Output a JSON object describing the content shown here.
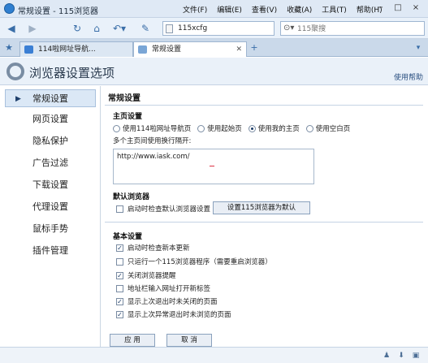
{
  "window": {
    "title": "常规设置 - 115浏览器"
  },
  "menu": [
    "文件(F)",
    "编辑(E)",
    "查看(V)",
    "收藏(A)",
    "工具(T)",
    "帮助(H)"
  ],
  "toolbar": {
    "url": "115xcfg",
    "search_placeholder": "115聚搜"
  },
  "tabs": [
    {
      "label": "114啦网址导航...",
      "active": false
    },
    {
      "label": "常规设置",
      "active": true
    }
  ],
  "page": {
    "heading": "浏览器设置选项",
    "help": "使用帮助"
  },
  "sidebar": {
    "items": [
      {
        "label": "常规设置",
        "active": true
      },
      {
        "label": "网页设置"
      },
      {
        "label": "隐私保护"
      },
      {
        "label": "广告过滤"
      },
      {
        "label": "下载设置"
      },
      {
        "label": "代理设置"
      },
      {
        "label": "鼠标手势"
      },
      {
        "label": "插件管理"
      }
    ]
  },
  "content": {
    "title": "常规设置",
    "homepage": {
      "heading": "主页设置",
      "options": [
        {
          "label": "使用114啦网址导航页",
          "checked": false
        },
        {
          "label": "使用起始页",
          "checked": false
        },
        {
          "label": "使用我的主页",
          "checked": true
        },
        {
          "label": "使用空白页",
          "checked": false
        }
      ],
      "hint": "多个主页间使用换行隔开:",
      "textarea": "http://www.iask.com/"
    },
    "default_browser": {
      "heading": "默认浏览器",
      "check_label": "启动时检查默认浏览器设置",
      "checked": false,
      "button": "设置115浏览器为默认"
    },
    "basic": {
      "heading": "基本设置",
      "items": [
        {
          "label": "启动时检查新本更新",
          "checked": true
        },
        {
          "label": "只运行一个115浏览器程序（需要重启浏览器）",
          "checked": false
        },
        {
          "label": "关闭浏览器提醒",
          "checked": true
        },
        {
          "label": "地址栏输入网址打开新标签",
          "checked": false
        },
        {
          "label": "显示上次退出时未关闭的页面",
          "checked": true
        },
        {
          "label": "显示上次异常退出时未浏览的页面",
          "checked": true
        }
      ]
    },
    "apply": "应 用",
    "cancel": "取 消"
  },
  "colors": {
    "accent": "#3a6ea8",
    "sidebar_active": "#dbe8f6"
  }
}
